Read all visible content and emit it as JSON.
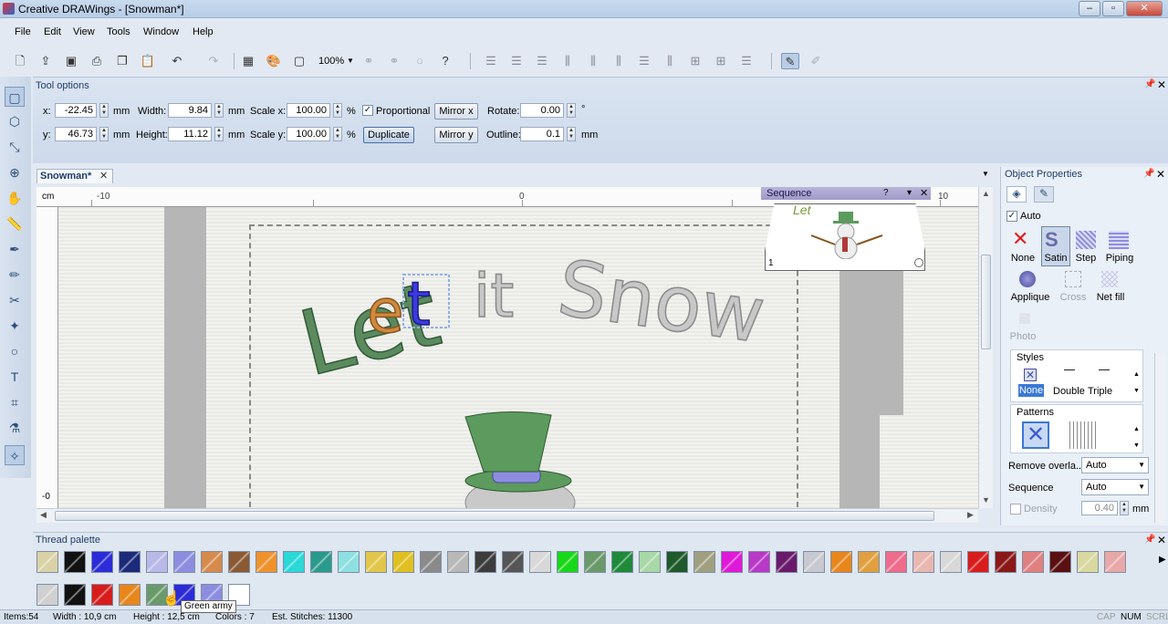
{
  "window": {
    "title": "Creative DRAWings - [Snowman*]"
  },
  "menu": [
    "File",
    "Edit",
    "View",
    "Tools",
    "Window",
    "Help"
  ],
  "toolbar": {
    "zoom": "100%"
  },
  "tool_options": {
    "title": "Tool options",
    "x_label": "x:",
    "x_value": "-22.45",
    "y_label": "y:",
    "y_value": "46.73",
    "width_label": "Width:",
    "width_value": "9.84",
    "height_label": "Height:",
    "height_value": "11.12",
    "scale_x_label": "Scale x:",
    "scale_x_value": "100.00",
    "scale_y_label": "Scale y:",
    "scale_y_value": "100.00",
    "unit_mm": "mm",
    "unit_pct": "%",
    "unit_deg": "°",
    "proportional": "Proportional",
    "duplicate": "Duplicate",
    "mirror_x": "Mirror x",
    "mirror_y": "Mirror y",
    "rotate_label": "Rotate:",
    "rotate_value": "0.00",
    "outline_label": "Outline:",
    "outline_value": "0.1"
  },
  "document": {
    "tab": "Snowman*",
    "ruler_unit": "cm",
    "ruler_ticks": [
      "-10",
      "0",
      "10"
    ],
    "vruler_tick": "-0"
  },
  "design": {
    "word1": "Let",
    "word2": "it",
    "word3": "Snow"
  },
  "sequence": {
    "title": "Sequence",
    "num": "1",
    "preview_text": "Let"
  },
  "object_properties": {
    "title": "Object Properties",
    "auto": "Auto",
    "fills": [
      "None",
      "Satin",
      "Step",
      "Piping",
      "Applique",
      "Cross",
      "Net fill",
      "Photo"
    ],
    "styles_title": "Styles",
    "styles": [
      "None",
      "Double",
      "Triple"
    ],
    "patterns_title": "Patterns",
    "remove_overlap_label": "Remove overla...",
    "remove_overlap_value": "Auto",
    "sequence_label": "Sequence",
    "sequence_value": "Auto",
    "density_label": "Density",
    "density_value": "0.40",
    "density_unit": "mm"
  },
  "thread_palette": {
    "title": "Thread palette",
    "row1": [
      "#d9d2a6",
      "#111111",
      "#2b2bd8",
      "#1c2a7a",
      "#b9b9e8",
      "#8d8de0",
      "#d68a4c",
      "#8a5a34",
      "#f0922c",
      "#2ad8d8",
      "#2a9a8c",
      "#8ee0e0",
      "#e2c64a",
      "#e0c020",
      "#8a8a8a",
      "#b8b8b8",
      "#3c3c3c",
      "#555555",
      "#d8d8d8",
      "#18d818",
      "#6a9a6a",
      "#1e8a3a",
      "#a8d8a8",
      "#1e5a2a",
      "#a0a080",
      "#e018d8",
      "#b838c8",
      "#6a1a6a",
      "#c8c8d0",
      "#e8861c",
      "#e0a040",
      "#f06c8c",
      "#e8b8b0",
      "#d8d8d8",
      "#d81c1c",
      "#8a1818",
      "#e08080",
      "#5a1010",
      "#d8d8a0",
      "#e8a8a8"
    ],
    "row2": [
      "#d0d0d0",
      "#111111",
      "#d81c1c",
      "#e8861c",
      "#6a9a6a",
      "#2b2bd8",
      "#8d8de0",
      "#ffffff"
    ],
    "tooltip": "Green army"
  },
  "status": {
    "items": "Items:54",
    "width": "Width : 10,9 cm",
    "height": "Height : 12,5 cm",
    "colors": "Colors : 7",
    "stitches": "Est. Stitches: 11300",
    "caps": "CAP",
    "num": "NUM",
    "scrl": "SCRL"
  }
}
